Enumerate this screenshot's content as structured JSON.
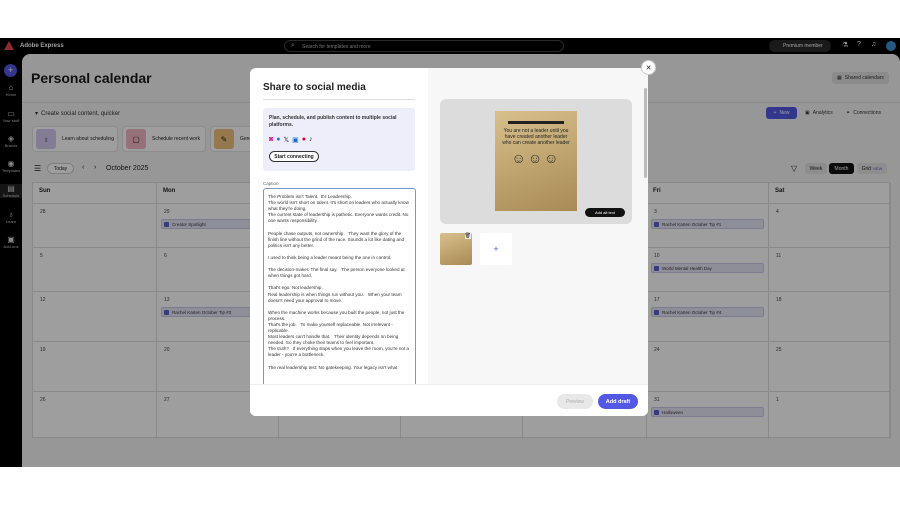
{
  "app": {
    "name": "Adobe Express",
    "search_placeholder": "Search for templates and more",
    "premium": "Premium member",
    "brand_color": "#5258e4"
  },
  "sidebar": {
    "items": [
      {
        "label": "Home",
        "icon": "home-icon"
      },
      {
        "label": "Your stuff",
        "icon": "folder-icon"
      },
      {
        "label": "Brands",
        "icon": "brand-icon"
      },
      {
        "label": "Templates",
        "icon": "templates-icon"
      },
      {
        "label": "Schedule",
        "icon": "calendar-icon"
      },
      {
        "label": "Learn",
        "icon": "lightbulb-icon"
      },
      {
        "label": "Add-ons",
        "icon": "addons-icon"
      }
    ]
  },
  "page": {
    "title": "Personal calendar",
    "shared_calendars": "Shared calendars",
    "section": "Create social content, quicker",
    "new_label": "New",
    "analytics": "Analytics",
    "connections": "Connections",
    "quick": [
      "Learn about scheduling",
      "Schedule recent work",
      "Gene"
    ],
    "today": "Today",
    "month_label": "October 2025",
    "views": [
      "Week",
      "Month",
      "Grid"
    ],
    "grid_badge": "NEW",
    "active_view": "Month"
  },
  "calendar": {
    "headers": [
      "Sun",
      "Mon",
      "",
      "",
      "",
      "Fri",
      "Sat"
    ],
    "weeks": [
      {
        "sun": "28",
        "mon": "29",
        "mon_ev": "Creator Spotlight",
        "fri": "3",
        "fri_ev": "Rachel Karten October Tip #1",
        "sat": "4"
      },
      {
        "sun": "5",
        "mon": "6",
        "fri": "10",
        "fri_ev": "World Mental Health Day",
        "sat": "11"
      },
      {
        "sun": "12",
        "mon": "13",
        "mon_ev": "Rachel Karten October Tip #3",
        "fri": "17",
        "fri_ev": "Rachel Karten October Tip #4",
        "sat": "18"
      },
      {
        "sun": "19",
        "mon": "20",
        "fri": "24",
        "sat": "25"
      },
      {
        "sun": "26",
        "mon": "27",
        "fri": "31",
        "fri_ev": "Halloween",
        "sat": "1"
      }
    ]
  },
  "modal": {
    "title": "Share to social media",
    "promo": "Plan, schedule, and publish content to multiple social platforms.",
    "start": "Start connecting",
    "caption_label": "Caption",
    "caption": "The Problem isn't Talent.  It's Leadership.\nThe world isn't short on talent. It's short on leaders who actually know what they're doing.\nThe current state of leadership is pathetic. Everyone wants credit. No one wants responsibility.\n\nPeople chase outputs, not ownership.   They want the glory of the finish line without the grind of the race. Sounds a lot like dating and politics isn't any better.\n\nI used to think being a leader meant being the one in control.\n\nThe decision-maker. The final say.   The person everyone looked at when things got hard.\n\nThat's ego. Not leadership.\nReal leadership is when things run without you.   When your team doesn't need your approval to move.\n\nWhen the machine works because you built the people, not just the process.\nThat's the job.   To make yourself replaceable. Not irrelevant - replicable.\nMost leaders can't handle that.   Their identity depends on being needed. So they choke their teams to feel important.\nThe truth?   If everything stops when you leave the room, you're not a leader - you're a bottleneck.\n\nThe real leadership test: No gatekeeping. Your legacy isn't what",
    "image_text": "You are not a leader until you have created another leader who can create another leader",
    "alt_text": "Add alt text",
    "preview": "Preview",
    "add_draft": "Add draft",
    "add_media": "+"
  }
}
